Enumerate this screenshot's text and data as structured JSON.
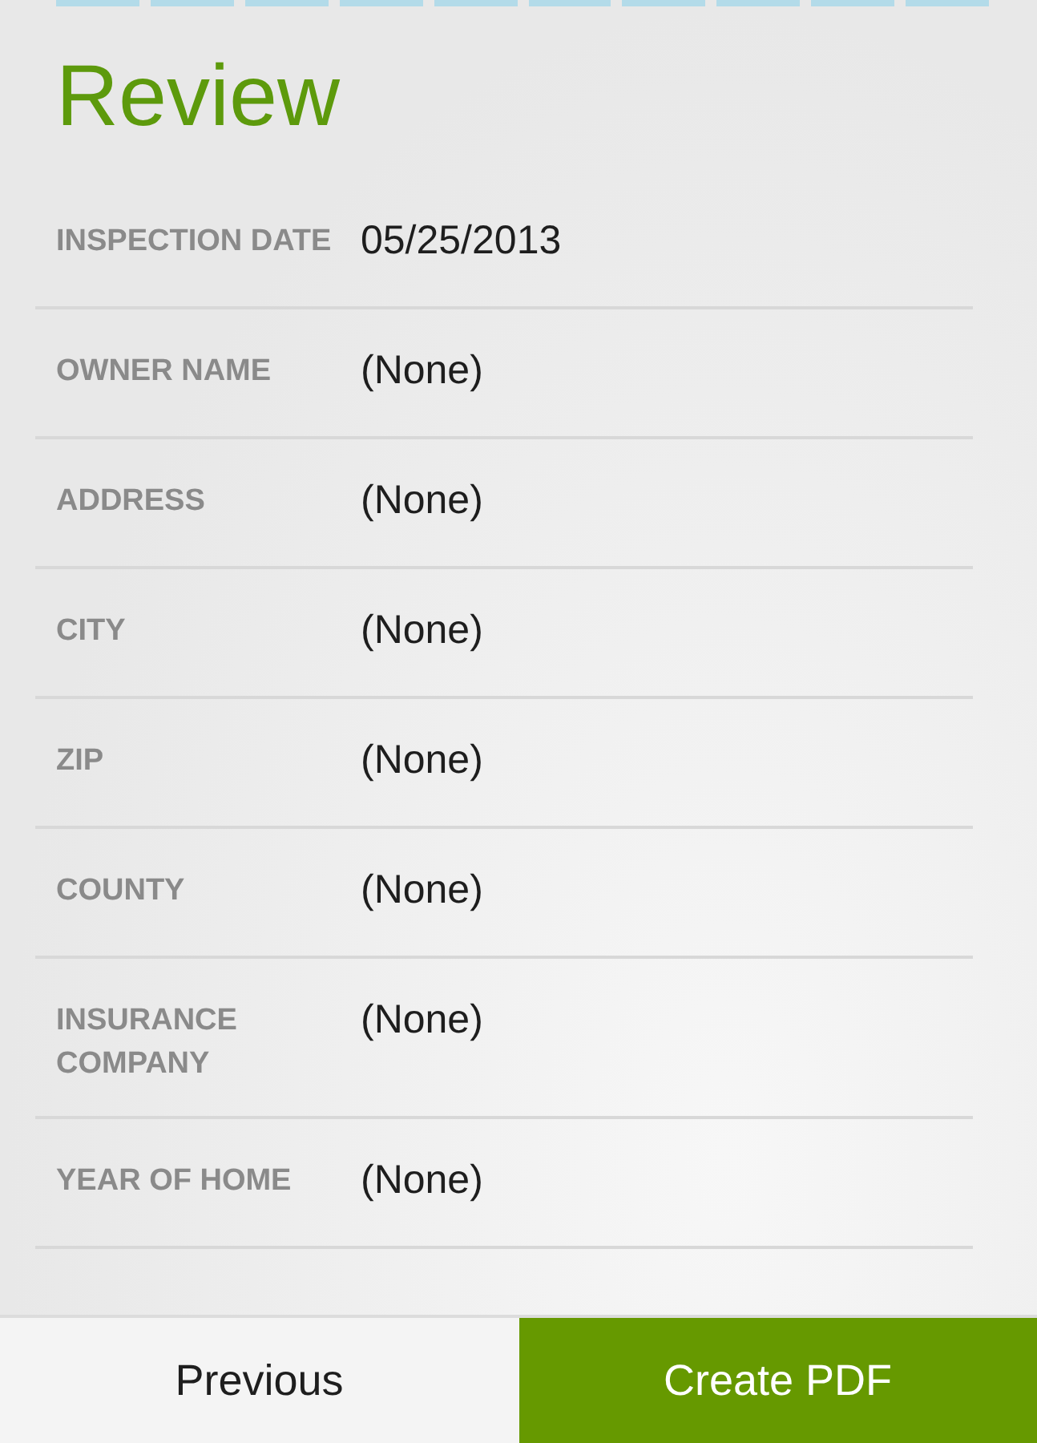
{
  "progress": [
    {
      "done": true
    },
    {
      "done": true
    },
    {
      "done": true
    },
    {
      "done": true
    },
    {
      "done": true
    },
    {
      "done": true
    },
    {
      "done": true
    },
    {
      "done": true
    },
    {
      "done": true
    },
    {
      "done": true
    }
  ],
  "title": "Review",
  "fields": [
    {
      "label": "INSPECTION DATE",
      "value": "05/25/2013"
    },
    {
      "label": "OWNER NAME",
      "value": "(None)"
    },
    {
      "label": "ADDRESS",
      "value": "(None)"
    },
    {
      "label": "CITY",
      "value": "(None)"
    },
    {
      "label": "ZIP",
      "value": "(None)"
    },
    {
      "label": "COUNTY",
      "value": "(None)"
    },
    {
      "label": "INSURANCE COMPANY",
      "value": "(None)"
    },
    {
      "label": "YEAR OF HOME",
      "value": "(None)"
    }
  ],
  "buttons": [
    {
      "label": "Previous",
      "kind": "secondary"
    },
    {
      "label": "Create PDF",
      "kind": "primary"
    }
  ]
}
